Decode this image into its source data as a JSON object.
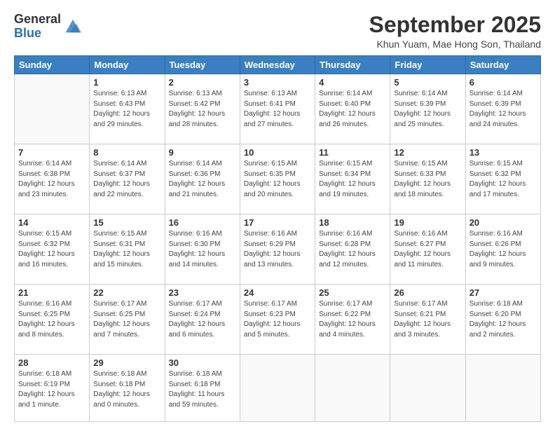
{
  "logo": {
    "general": "General",
    "blue": "Blue"
  },
  "header": {
    "month": "September 2025",
    "location": "Khun Yuam, Mae Hong Son, Thailand"
  },
  "weekdays": [
    "Sunday",
    "Monday",
    "Tuesday",
    "Wednesday",
    "Thursday",
    "Friday",
    "Saturday"
  ],
  "weeks": [
    [
      {
        "day": "",
        "info": ""
      },
      {
        "day": "1",
        "info": "Sunrise: 6:13 AM\nSunset: 6:43 PM\nDaylight: 12 hours\nand 29 minutes."
      },
      {
        "day": "2",
        "info": "Sunrise: 6:13 AM\nSunset: 6:42 PM\nDaylight: 12 hours\nand 28 minutes."
      },
      {
        "day": "3",
        "info": "Sunrise: 6:13 AM\nSunset: 6:41 PM\nDaylight: 12 hours\nand 27 minutes."
      },
      {
        "day": "4",
        "info": "Sunrise: 6:14 AM\nSunset: 6:40 PM\nDaylight: 12 hours\nand 26 minutes."
      },
      {
        "day": "5",
        "info": "Sunrise: 6:14 AM\nSunset: 6:39 PM\nDaylight: 12 hours\nand 25 minutes."
      },
      {
        "day": "6",
        "info": "Sunrise: 6:14 AM\nSunset: 6:39 PM\nDaylight: 12 hours\nand 24 minutes."
      }
    ],
    [
      {
        "day": "7",
        "info": "Sunrise: 6:14 AM\nSunset: 6:38 PM\nDaylight: 12 hours\nand 23 minutes."
      },
      {
        "day": "8",
        "info": "Sunrise: 6:14 AM\nSunset: 6:37 PM\nDaylight: 12 hours\nand 22 minutes."
      },
      {
        "day": "9",
        "info": "Sunrise: 6:14 AM\nSunset: 6:36 PM\nDaylight: 12 hours\nand 21 minutes."
      },
      {
        "day": "10",
        "info": "Sunrise: 6:15 AM\nSunset: 6:35 PM\nDaylight: 12 hours\nand 20 minutes."
      },
      {
        "day": "11",
        "info": "Sunrise: 6:15 AM\nSunset: 6:34 PM\nDaylight: 12 hours\nand 19 minutes."
      },
      {
        "day": "12",
        "info": "Sunrise: 6:15 AM\nSunset: 6:33 PM\nDaylight: 12 hours\nand 18 minutes."
      },
      {
        "day": "13",
        "info": "Sunrise: 6:15 AM\nSunset: 6:32 PM\nDaylight: 12 hours\nand 17 minutes."
      }
    ],
    [
      {
        "day": "14",
        "info": "Sunrise: 6:15 AM\nSunset: 6:32 PM\nDaylight: 12 hours\nand 16 minutes."
      },
      {
        "day": "15",
        "info": "Sunrise: 6:15 AM\nSunset: 6:31 PM\nDaylight: 12 hours\nand 15 minutes."
      },
      {
        "day": "16",
        "info": "Sunrise: 6:16 AM\nSunset: 6:30 PM\nDaylight: 12 hours\nand 14 minutes."
      },
      {
        "day": "17",
        "info": "Sunrise: 6:16 AM\nSunset: 6:29 PM\nDaylight: 12 hours\nand 13 minutes."
      },
      {
        "day": "18",
        "info": "Sunrise: 6:16 AM\nSunset: 6:28 PM\nDaylight: 12 hours\nand 12 minutes."
      },
      {
        "day": "19",
        "info": "Sunrise: 6:16 AM\nSunset: 6:27 PM\nDaylight: 12 hours\nand 11 minutes."
      },
      {
        "day": "20",
        "info": "Sunrise: 6:16 AM\nSunset: 6:26 PM\nDaylight: 12 hours\nand 9 minutes."
      }
    ],
    [
      {
        "day": "21",
        "info": "Sunrise: 6:16 AM\nSunset: 6:25 PM\nDaylight: 12 hours\nand 8 minutes."
      },
      {
        "day": "22",
        "info": "Sunrise: 6:17 AM\nSunset: 6:25 PM\nDaylight: 12 hours\nand 7 minutes."
      },
      {
        "day": "23",
        "info": "Sunrise: 6:17 AM\nSunset: 6:24 PM\nDaylight: 12 hours\nand 6 minutes."
      },
      {
        "day": "24",
        "info": "Sunrise: 6:17 AM\nSunset: 6:23 PM\nDaylight: 12 hours\nand 5 minutes."
      },
      {
        "day": "25",
        "info": "Sunrise: 6:17 AM\nSunset: 6:22 PM\nDaylight: 12 hours\nand 4 minutes."
      },
      {
        "day": "26",
        "info": "Sunrise: 6:17 AM\nSunset: 6:21 PM\nDaylight: 12 hours\nand 3 minutes."
      },
      {
        "day": "27",
        "info": "Sunrise: 6:18 AM\nSunset: 6:20 PM\nDaylight: 12 hours\nand 2 minutes."
      }
    ],
    [
      {
        "day": "28",
        "info": "Sunrise: 6:18 AM\nSunset: 6:19 PM\nDaylight: 12 hours\nand 1 minute."
      },
      {
        "day": "29",
        "info": "Sunrise: 6:18 AM\nSunset: 6:18 PM\nDaylight: 12 hours\nand 0 minutes."
      },
      {
        "day": "30",
        "info": "Sunrise: 6:18 AM\nSunset: 6:18 PM\nDaylight: 11 hours\nand 59 minutes."
      },
      {
        "day": "",
        "info": ""
      },
      {
        "day": "",
        "info": ""
      },
      {
        "day": "",
        "info": ""
      },
      {
        "day": "",
        "info": ""
      }
    ]
  ]
}
